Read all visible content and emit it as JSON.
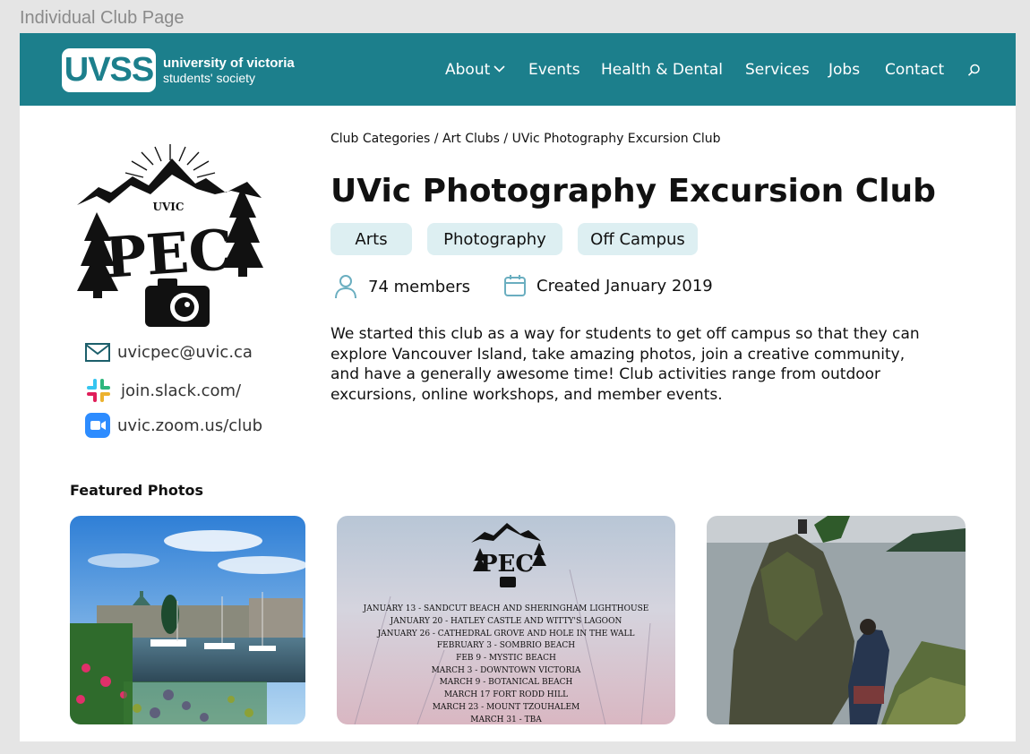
{
  "frame_label": "Individual Club Page",
  "header": {
    "logo_mark": "UVSS",
    "logo_line1": "university of victoria",
    "logo_line2": "students' society",
    "nav": [
      "About",
      "Events",
      "Health & Dental",
      "Services",
      "Jobs",
      "Contact"
    ]
  },
  "breadcrumb": {
    "items": [
      "Club Categories",
      "Art Clubs",
      "UVic Photography Excursion Club"
    ],
    "separator": " / "
  },
  "club": {
    "name": "UVic Photography Excursion Club",
    "tags": [
      "Arts",
      "Photography",
      "Off Campus"
    ],
    "members": "74 members",
    "created": "Created January 2019",
    "description": "We started this club as a way for students to get off campus so that they can explore Vancouver Island, take amazing photos, join a creative community, and have a generally awesome time! Club activities range from outdoor excursions, online workshops, and member events.",
    "logo_text_small": "UVIC",
    "logo_text_large": "PEC"
  },
  "contacts": {
    "email": "uvicpec@uvic.ca",
    "slack": "join.slack.com/",
    "zoom": "uvic.zoom.us/club"
  },
  "featured": {
    "heading": "Featured Photos",
    "poster_schedule": [
      "JANUARY 13 - SANDCUT BEACH AND SHERINGHAM LIGHTHOUSE",
      "JANUARY 20 - HATLEY CASTLE AND WITTY'S LAGOON",
      "JANUARY 26 - CATHEDRAL GROVE AND HOLE IN THE WALL",
      "FEBRUARY 3 - SOMBRIO BEACH",
      "FEB 9 - MYSTIC BEACH",
      "MARCH 3 - DOWNTOWN VICTORIA",
      "MARCH 9 - BOTANICAL BEACH",
      "MARCH 17 FORT RODD HILL",
      "MARCH 23 - MOUNT TZOUHALEM",
      "MARCH 31 - TBA"
    ]
  },
  "colors": {
    "brand": "#1c7f8c",
    "tag_bg": "#ddeff2",
    "icon_accent": "#6aaec0"
  }
}
